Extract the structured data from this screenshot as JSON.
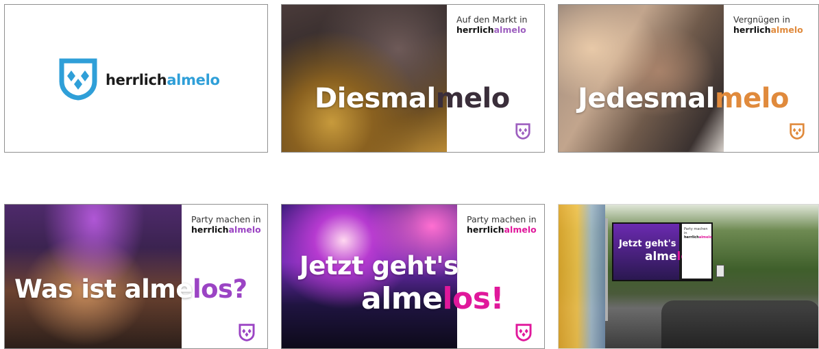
{
  "logo_card": {
    "brand_dark": "herrlich",
    "brand_color": "almelo"
  },
  "cards": [
    {
      "tagline": "Auf den Markt in",
      "brand_dark": "herrlich",
      "brand_color": "almelo",
      "headline_white": "Diesmal",
      "headline_color": "melo",
      "accent": "#9d5fbf"
    },
    {
      "tagline": "Vergnügen in",
      "brand_dark": "herrlich",
      "brand_color": "almelo",
      "headline_white": "Jedesmal",
      "headline_color": "melo",
      "accent": "#e08a3c"
    },
    {
      "tagline": "Party machen in",
      "brand_dark": "herrlich",
      "brand_color": "almelo",
      "headline_white": "Was ist alme",
      "headline_color": "los?",
      "accent": "#9b44c4"
    },
    {
      "tagline": "Party machen in",
      "brand_dark": "herrlich",
      "brand_color": "almelo",
      "headline_line1": "Jetzt geht's",
      "headline_white": "alme",
      "headline_color": "los!",
      "accent": "#e0189b"
    },
    {
      "billboard_line1": "Jetzt geht's",
      "billboard_white": "alme",
      "billboard_color": "los!",
      "billboard_tagline": "Party machen in",
      "billboard_brand_dark": "herrlich",
      "billboard_brand_color": "almelo",
      "accent": "#e0189b"
    }
  ],
  "colors": {
    "logo_blue": "#2f9fd8"
  },
  "icons": [
    "shield-logo-icon"
  ]
}
